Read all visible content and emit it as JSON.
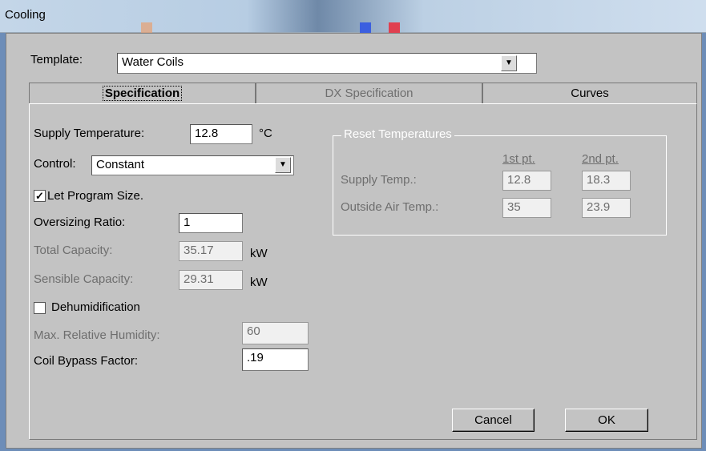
{
  "window": {
    "title": "Cooling"
  },
  "template": {
    "label": "Template:",
    "value": "Water Coils"
  },
  "tabs": [
    {
      "label": "Specification",
      "active": true
    },
    {
      "label": "DX Specification",
      "disabled": true
    },
    {
      "label": "Curves"
    }
  ],
  "spec": {
    "supply_temp_label": "Supply Temperature:",
    "supply_temp_value": "12.8",
    "supply_temp_unit": "°C",
    "control_label": "Control:",
    "control_value": "Constant",
    "let_program_size_label": "Let Program Size.",
    "let_program_size_checked": true,
    "oversizing_label": "Oversizing Ratio:",
    "oversizing_value": "1",
    "total_capacity_label": "Total Capacity:",
    "total_capacity_value": "35.17",
    "total_capacity_unit": "kW",
    "sensible_capacity_label": "Sensible Capacity:",
    "sensible_capacity_value": "29.31",
    "sensible_capacity_unit": "kW",
    "dehumidification_label": "Dehumidification",
    "dehumidification_checked": false,
    "max_rh_label": "Max. Relative Humidity:",
    "max_rh_value": "60",
    "bypass_label": "Coil Bypass Factor:",
    "bypass_value": ".19"
  },
  "reset": {
    "title": "Reset Temperatures",
    "col1": "1st pt.",
    "col2": "2nd pt.",
    "supply_label": "Supply Temp.:",
    "supply_1": "12.8",
    "supply_2": "18.3",
    "oat_label": "Outside Air Temp.:",
    "oat_1": "35",
    "oat_2": "23.9"
  },
  "buttons": {
    "cancel": "Cancel",
    "ok": "OK"
  },
  "icons": {
    "dropdown": "dropdown-arrow-icon",
    "check": "checkmark-icon"
  }
}
